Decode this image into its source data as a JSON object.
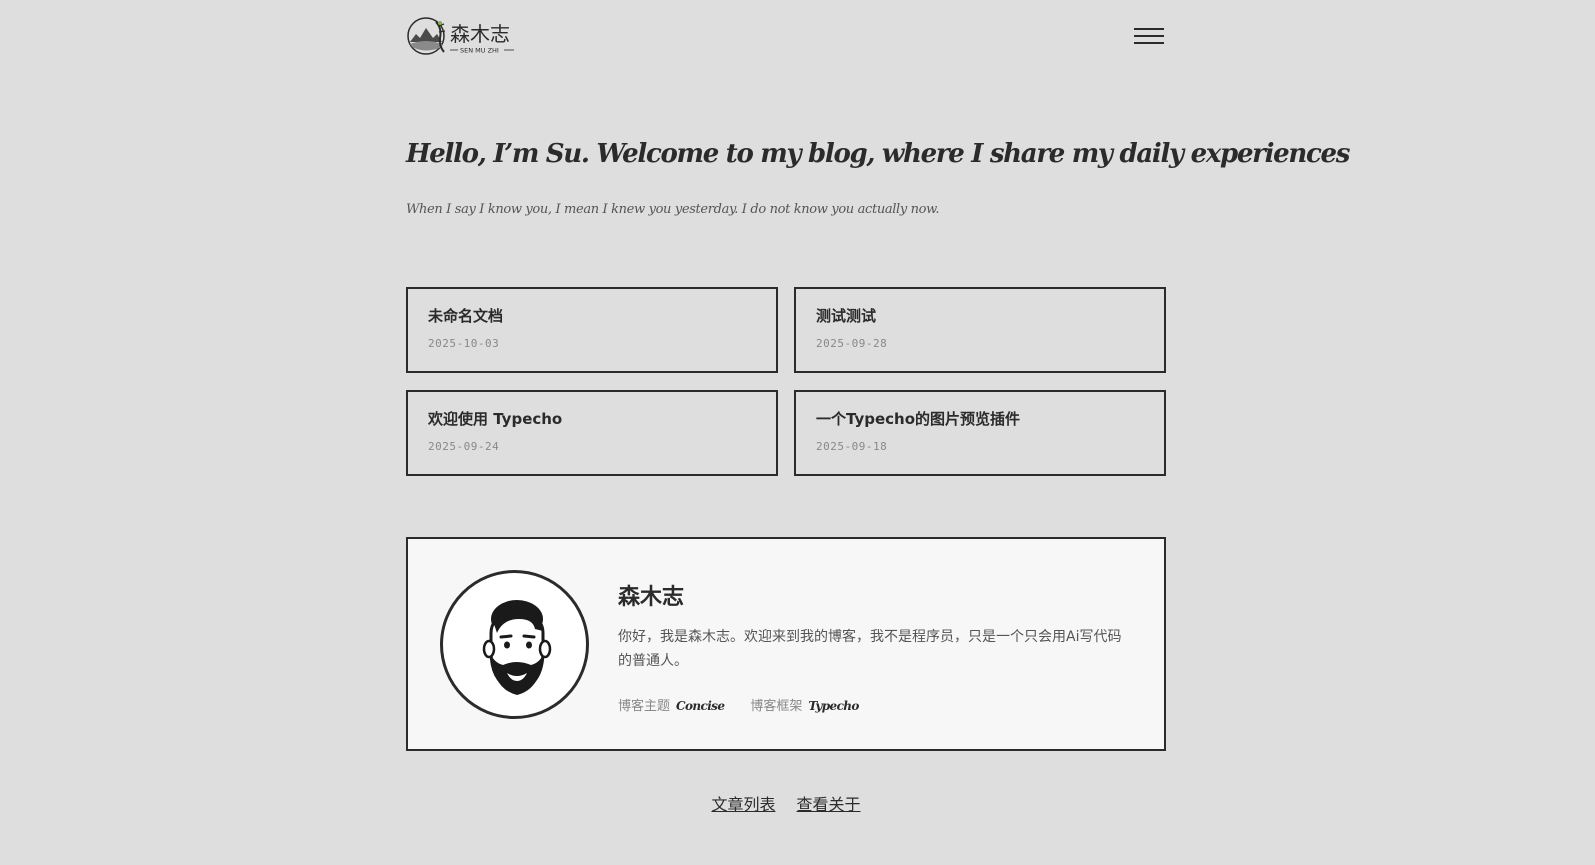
{
  "site": {
    "logo_main": "森木志",
    "logo_sub": "SEN MU ZHI"
  },
  "hero": {
    "title": "Hello, I’m Su. Welcome to my blog, where I share my daily experiences",
    "subtitle": "When I say I know you, I mean I knew you yesterday. I do not know you actually now."
  },
  "posts": [
    {
      "title": "未命名文档",
      "date": "2025-10-03"
    },
    {
      "title": "测试测试",
      "date": "2025-09-28"
    },
    {
      "title": "欢迎使用 Typecho",
      "date": "2025-09-24"
    },
    {
      "title": "一个Typecho的图片预览插件",
      "date": "2025-09-18"
    }
  ],
  "profile": {
    "name": "森木志",
    "bio": "你好，我是森木志。欢迎来到我的博客，我不是程序员，只是一个只会用Ai写代码的普通人。",
    "theme_label": "博客主题",
    "theme_value": "Concise",
    "framework_label": "博客框架",
    "framework_value": "Typecho"
  },
  "footer": {
    "links": [
      "文章列表",
      "查看关于"
    ]
  },
  "icons": {
    "menu": "hamburger-menu-icon",
    "avatar": "bearded-man-avatar"
  },
  "colors": {
    "background": "#dedede",
    "text": "#2b2b2b",
    "card_background": "#f7f7f7",
    "muted": "#888888"
  }
}
